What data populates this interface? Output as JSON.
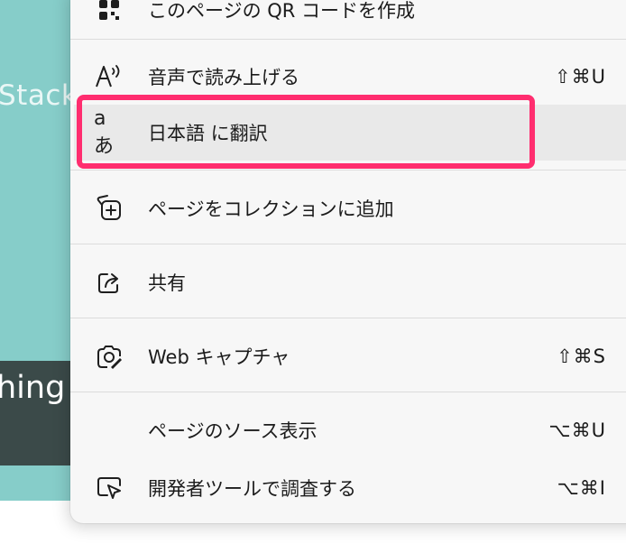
{
  "background": {
    "text_top": "Stack",
    "text_bottom": "hing"
  },
  "menu": {
    "items": [
      {
        "id": "qr",
        "label": "このページの QR コードを作成",
        "shortcut": "",
        "icon": "qr-code-icon"
      },
      {
        "id": "speak",
        "label": "音声で読み上げる",
        "shortcut": "⇧⌘U",
        "icon": "speak-text-icon"
      },
      {
        "id": "translate",
        "label": "日本語 に翻訳",
        "shortcut": "",
        "icon": "translate-icon"
      },
      {
        "id": "collection",
        "label": "ページをコレクションに追加",
        "shortcut": "",
        "icon": "add-collection-icon"
      },
      {
        "id": "share",
        "label": "共有",
        "shortcut": "",
        "icon": "share-icon"
      },
      {
        "id": "capture",
        "label": "Web キャプチャ",
        "shortcut": "⇧⌘S",
        "icon": "web-capture-icon"
      },
      {
        "id": "source",
        "label": "ページのソース表示",
        "shortcut": "⌥⌘U",
        "icon": ""
      },
      {
        "id": "devtools",
        "label": "開発者ツールで調査する",
        "shortcut": "⌥⌘I",
        "icon": "devtools-icon"
      }
    ],
    "translate_icon_glyph": "aあ"
  },
  "colors": {
    "highlight_border": "#ff2d6f",
    "background_teal": "#86cdc9",
    "background_dark": "#3b4a49"
  }
}
